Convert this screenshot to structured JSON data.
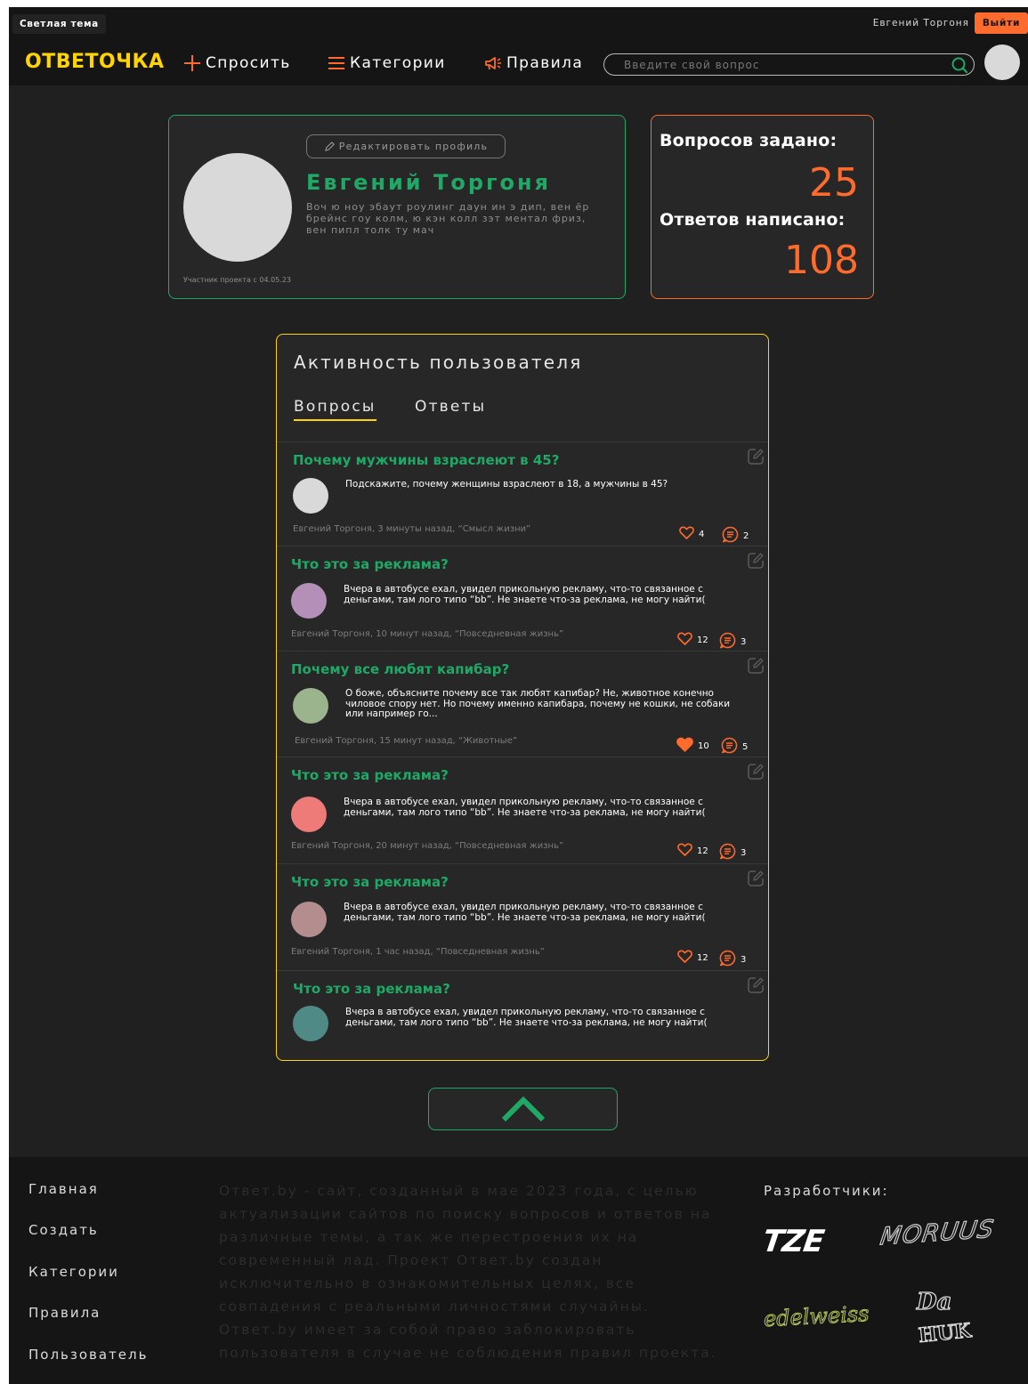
{
  "topbar": {
    "theme_toggle": "Светлая тема",
    "username": "Евгений Торгоня",
    "logout": "Выйти"
  },
  "navbar": {
    "logo": "ОТВЕТОЧКА",
    "ask": "Спросить",
    "categories": "Категории",
    "rules": "Правила",
    "search_placeholder": "Введите свой вопрос",
    "icons": {
      "ask": "plus-icon",
      "categories": "menu-icon",
      "rules": "megaphone-icon",
      "search": "search-icon"
    }
  },
  "profile": {
    "edit_label": "Редактировать профиль",
    "name": "Евгений Торгоня",
    "bio": "Воч ю ноу эбаут роулинг даун ин э дип, вен ёр брейнс гоу колм, ю кэн колл зэт ментал фриз, вен пипл толк ту мач",
    "since": "Участник проекта с 04.05.23"
  },
  "stats": {
    "questions_label": "Вопросов задано:",
    "questions_value": "25",
    "answers_label": "Ответов написано:",
    "answers_value": "108"
  },
  "activity": {
    "title": "Активность пользователя",
    "tabs": [
      "Вопросы",
      "Ответы"
    ],
    "items": [
      {
        "title": "Почему мужчины взраслеют в 45?",
        "text": "Подскажите, почему женщины взраслеют в 18, а мужчины в 45?",
        "meta": "Евгений Торгоня, 3 минуты назад, “Смысл жизни”",
        "likes": "4",
        "comments": "2",
        "avatar_color": "#d9d9d9",
        "liked": false
      },
      {
        "title": "Что это за реклама?",
        "text": "Вчера в автобусе ехал, увидел прикольную рекламу, что-то связанное с деньгами, там лого типо “bb”. Не знаете что-за реклама, не могу найти(",
        "meta": "Евгений Торгоня, 10 минут назад, “Повседневная жизнь”",
        "likes": "12",
        "comments": "3",
        "avatar_color": "#b48fb8",
        "liked": false
      },
      {
        "title": "Почему все любят капибар?",
        "text": "О боже, объясните почему все так любят капибар? Не, животное конечно чиловое спору нет. Но почему именно капибара, почему не кошки, не собаки или например го...",
        "meta": "Евгений Торгоня, 15 минут назад, “Животные”",
        "likes": "10",
        "comments": "5",
        "avatar_color": "#9cb48e",
        "liked": true
      },
      {
        "title": "Что это за реклама?",
        "text": "Вчера в автобусе ехал, увидел прикольную рекламу, что-то связанное с деньгами, там лого типо “bb”. Не знаете что-за реклама, не могу найти(",
        "meta": "Евгений Торгоня, 20 минут назад, “Повседневная жизнь”",
        "likes": "12",
        "comments": "3",
        "avatar_color": "#ef7b78",
        "liked": false
      },
      {
        "title": "Что это за реклама?",
        "text": "Вчера в автобусе ехал, увидел прикольную рекламу, что-то связанное с деньгами, там лого типо “bb”. Не знаете что-за реклама, не могу найти(",
        "meta": "Евгений Торгоня, 1 час назад, “Повседневная жизнь”",
        "likes": "12",
        "comments": "3",
        "avatar_color": "#b48e8e",
        "liked": false
      },
      {
        "title": "Что это за реклама?",
        "text": "Вчера в автобусе ехал, увидел прикольную рекламу, что-то связанное с деньгами, там лого типо “bb”. Не знаете что-за реклама, не могу найти(",
        "meta": "",
        "likes": "",
        "comments": "",
        "avatar_color": "#4f8a86",
        "liked": false
      }
    ]
  },
  "footer": {
    "links": [
      "Главная",
      "Создать",
      "Категории",
      "Правила",
      "Пользователь"
    ],
    "about": "Ответ.by - сайт, созданный в мае 2023 года, с целью актуализации сайтов по поиску вопросов и ответов на различные темы, а так же перестроения их на современный лад. Проект Ответ.by создан исключительно в ознакомительных целях, все совпадения с реальными личностями случайны. Ответ.by имеет за собой право заблокировать пользователя в случае не соблюдения правил проекта.",
    "devs_title": "Разработчики:",
    "devs": [
      "TZE",
      "MORUUS",
      "edelweiss",
      "Da",
      "HUK"
    ]
  },
  "colors": {
    "green": "#1fa866",
    "orange": "#ff6b2c",
    "yellow": "#ffd400",
    "background": "#202020"
  }
}
